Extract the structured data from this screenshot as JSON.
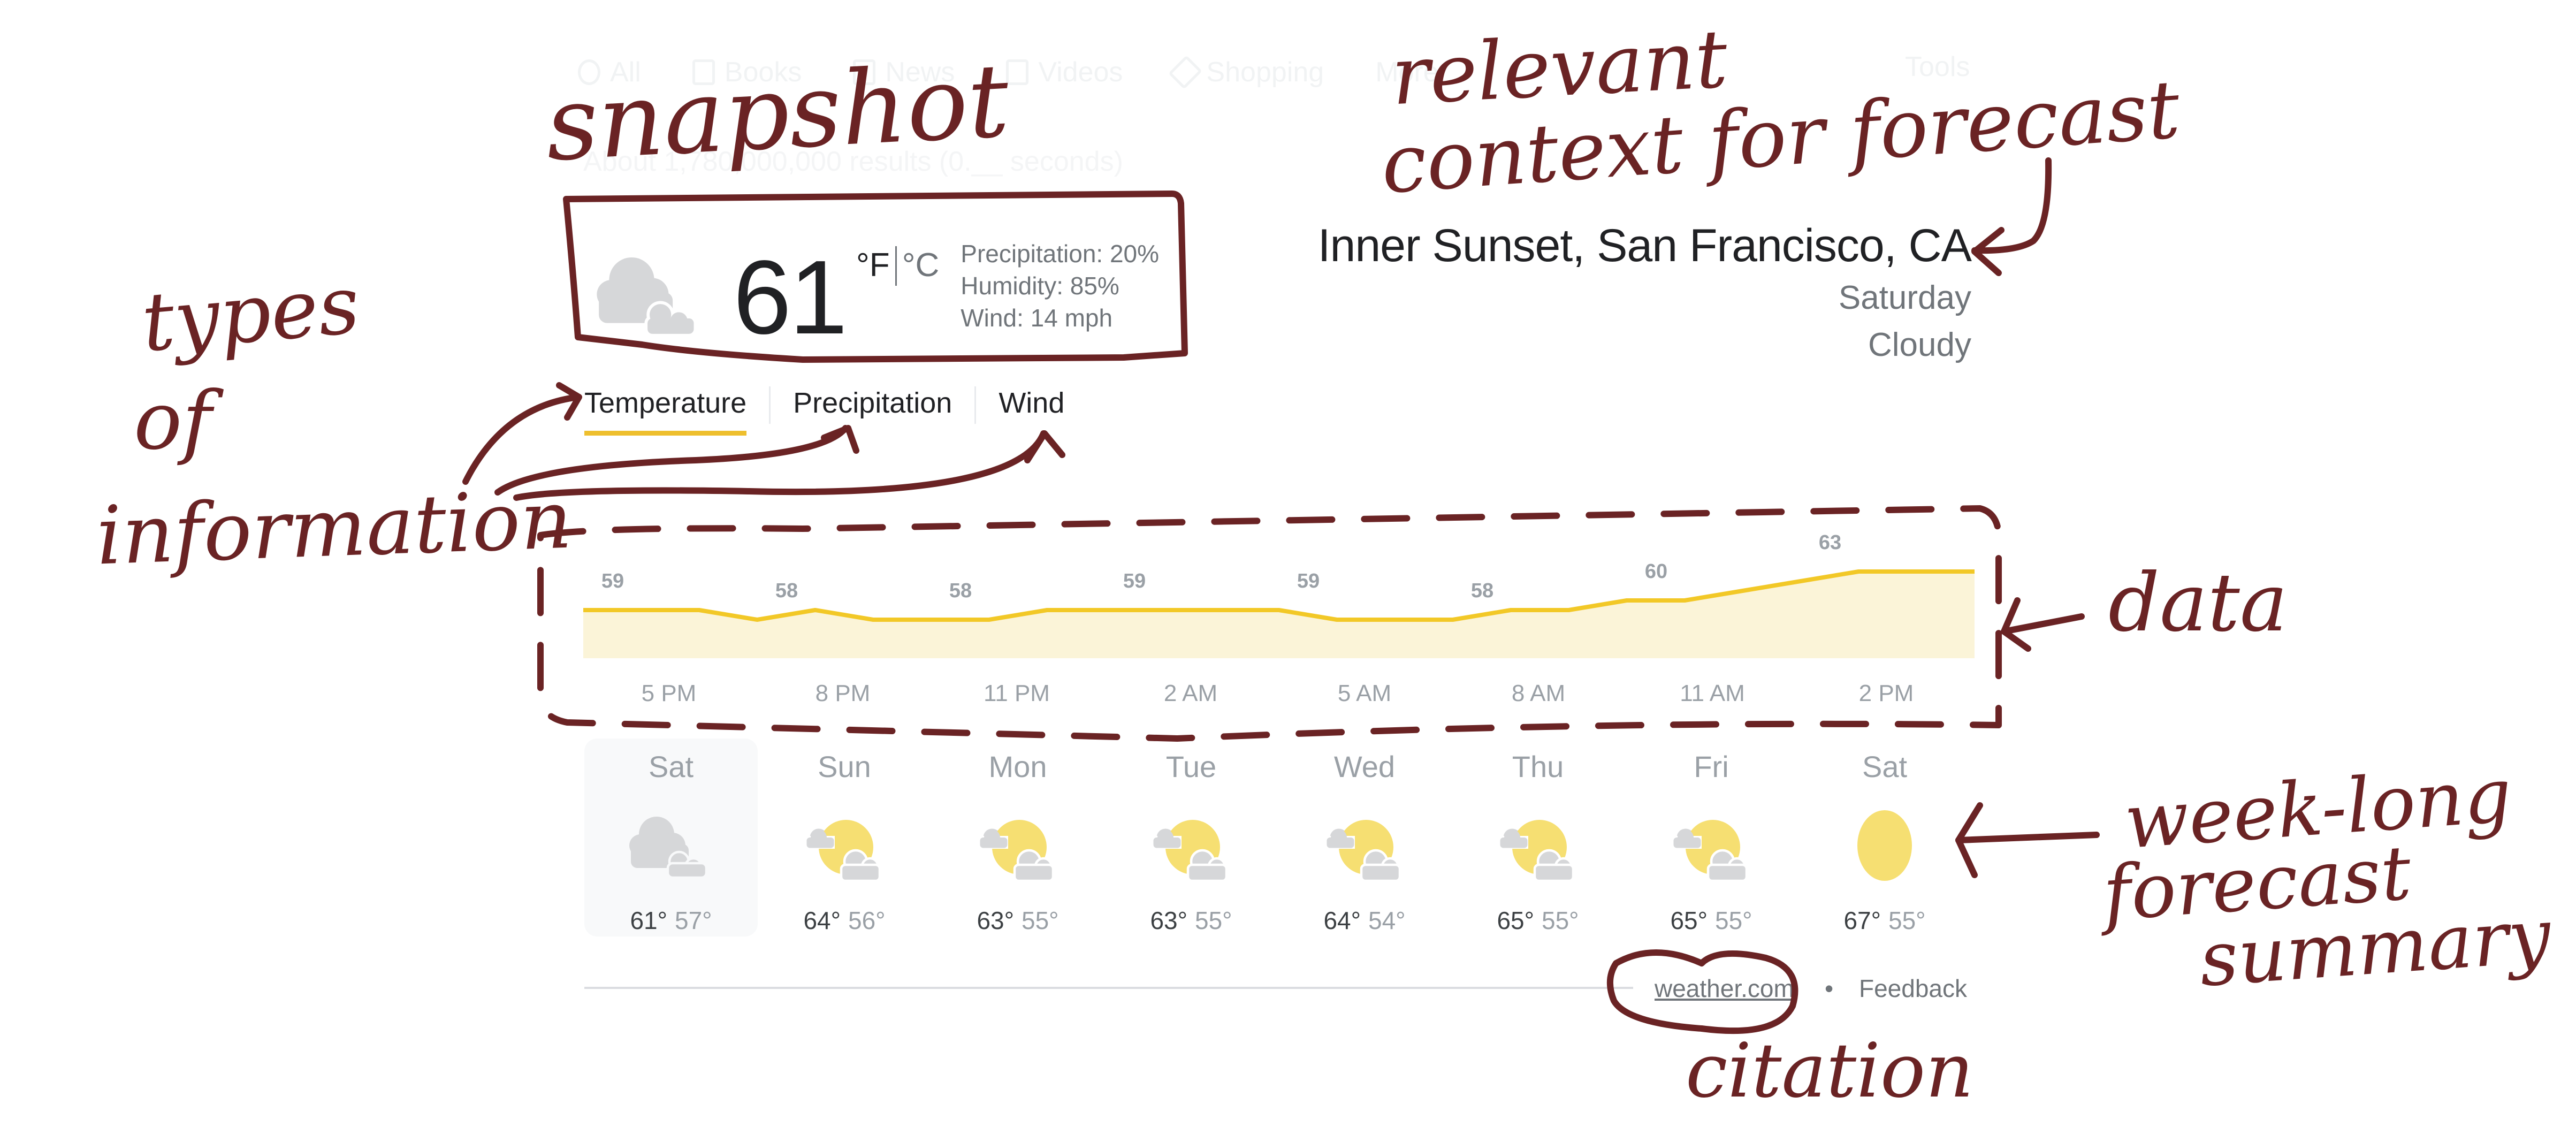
{
  "background": {
    "nav_items": [
      {
        "label": "All",
        "icon": "search-icon"
      },
      {
        "label": "Books",
        "icon": "book-icon"
      },
      {
        "label": "News",
        "icon": "newspaper-icon"
      },
      {
        "label": "Videos",
        "icon": "video-icon"
      },
      {
        "label": "Shopping",
        "icon": "tag-icon"
      },
      {
        "label": "More",
        "icon": "more-icon"
      }
    ],
    "tools_label": "Tools",
    "result_stats": "About 1,780,000,000 results (0.__ seconds)"
  },
  "weather": {
    "current": {
      "icon": "cloudy-icon",
      "temperature": "61",
      "unit_f": "°F",
      "unit_c": "°C",
      "active_unit": "F",
      "precipitation": "Precipitation: 20%",
      "humidity": "Humidity: 85%",
      "wind": "Wind: 14 mph"
    },
    "location": {
      "title": "Inner Sunset, San Francisco, CA",
      "day": "Saturday",
      "condition": "Cloudy"
    },
    "tabs": [
      {
        "label": "Temperature",
        "active": true
      },
      {
        "label": "Precipitation",
        "active": false
      },
      {
        "label": "Wind",
        "active": false
      }
    ],
    "forecast": [
      {
        "day": "Sat",
        "icon": "cloudy-icon",
        "high": "61°",
        "low": "57°",
        "selected": true
      },
      {
        "day": "Sun",
        "icon": "partly-cloudy-icon",
        "high": "64°",
        "low": "56°",
        "selected": false
      },
      {
        "day": "Mon",
        "icon": "partly-cloudy-icon",
        "high": "63°",
        "low": "55°",
        "selected": false
      },
      {
        "day": "Tue",
        "icon": "partly-cloudy-icon",
        "high": "63°",
        "low": "55°",
        "selected": false
      },
      {
        "day": "Wed",
        "icon": "partly-cloudy-icon",
        "high": "64°",
        "low": "54°",
        "selected": false
      },
      {
        "day": "Thu",
        "icon": "partly-cloudy-icon",
        "high": "65°",
        "low": "55°",
        "selected": false
      },
      {
        "day": "Fri",
        "icon": "partly-cloudy-icon",
        "high": "65°",
        "low": "55°",
        "selected": false
      },
      {
        "day": "Sat",
        "icon": "sunny-icon",
        "high": "67°",
        "low": "55°",
        "selected": false
      }
    ],
    "footer": {
      "source_label": "weather.com",
      "separator": "•",
      "feedback_label": "Feedback"
    },
    "colors": {
      "line": "#f2c827",
      "fill": "#fbf4d8",
      "accent_tab": "#eebf2e",
      "sun": "#f6df72",
      "cloud": "#d6d7d9"
    }
  },
  "chart_data": {
    "type": "area",
    "title": "Temperature",
    "xlabel": "",
    "ylabel": "",
    "ylim": [
      50,
      64
    ],
    "grid": false,
    "legend": "none",
    "tick_labels": [
      "5 PM",
      "8 PM",
      "11 PM",
      "2 AM",
      "5 AM",
      "8 AM",
      "11 AM",
      "2 PM"
    ],
    "hourly_values": [
      59,
      59,
      59,
      58,
      59,
      58,
      58,
      58,
      59,
      59,
      59,
      59,
      59,
      58,
      58,
      58,
      59,
      59,
      60,
      60,
      61,
      62,
      63,
      63,
      63
    ],
    "data_labels": [
      {
        "tick": "5 PM",
        "value": 59
      },
      {
        "tick": "8 PM",
        "value": 58
      },
      {
        "tick": "11 PM",
        "value": 58
      },
      {
        "tick": "2 AM",
        "value": 59
      },
      {
        "tick": "5 AM",
        "value": 59
      },
      {
        "tick": "8 AM",
        "value": 58
      },
      {
        "tick": "11 AM",
        "value": 60
      },
      {
        "tick": "2 PM",
        "value": 63
      }
    ]
  },
  "annotations": {
    "snapshot": "snapshot",
    "context_line1": "relevant",
    "context_line2": "context for forecast",
    "types_line1": "types",
    "types_line2": "of",
    "types_line3": "information",
    "data": "data",
    "week_line1": "week-long",
    "week_line2": "forecast",
    "week_line3": "summary",
    "citation": "citation"
  }
}
